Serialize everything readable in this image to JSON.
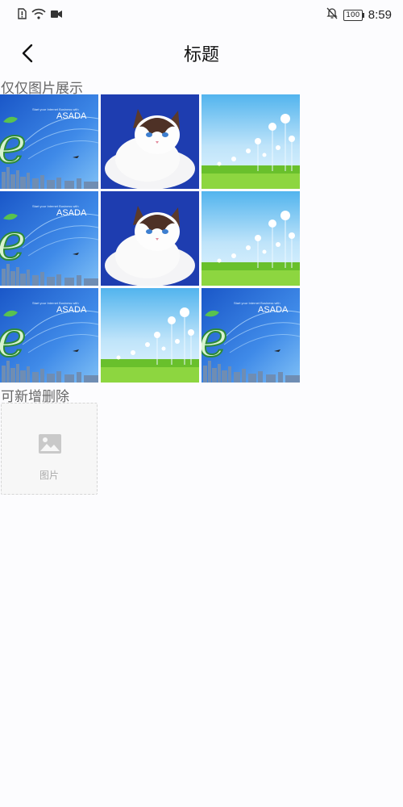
{
  "status_bar": {
    "time": "8:59",
    "battery": "100",
    "icons": [
      "sim-icon",
      "wifi-icon",
      "video-icon",
      "bell-off-icon"
    ]
  },
  "nav": {
    "title": "标题",
    "back_icon": "chevron-left-icon"
  },
  "sections": {
    "display_only": {
      "label": "仅仅图片展示",
      "images": [
        "e-banner",
        "cat",
        "meadow",
        "e-banner",
        "cat",
        "meadow",
        "e-banner",
        "meadow",
        "e-banner"
      ]
    },
    "editable": {
      "label": "可新增删除",
      "add_label": "图片",
      "add_icon": "image-icon"
    }
  },
  "banner_text": {
    "brand": "ASADA",
    "tagline": "Start your Internet Business with"
  }
}
